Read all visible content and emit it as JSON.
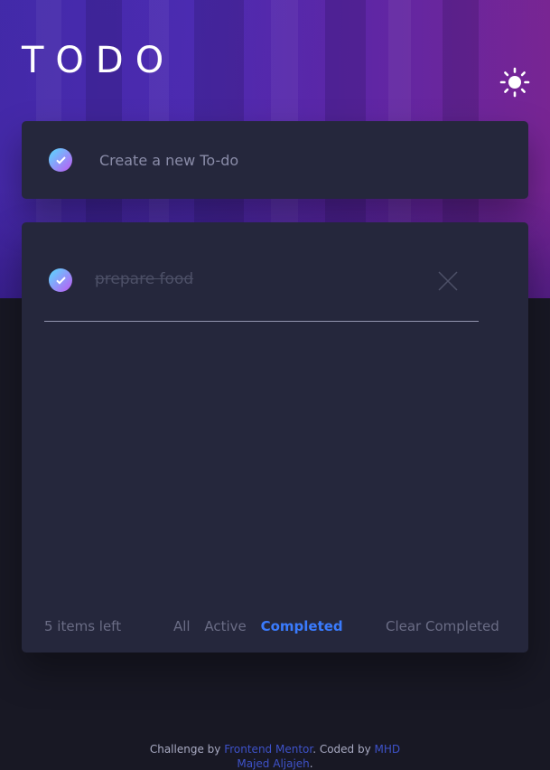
{
  "app": {
    "title": "TODO"
  },
  "theme_toggle": {
    "icon": "sun-icon"
  },
  "create": {
    "placeholder": "Create a new To-do",
    "value": ""
  },
  "todos": [
    {
      "text": "prepare food",
      "completed": true
    }
  ],
  "footer": {
    "items_left": "5 items left",
    "filters": [
      "All",
      "Active",
      "Completed"
    ],
    "active_filter": "Completed",
    "clear_label": "Clear Completed"
  },
  "attribution": {
    "prefix": "Challenge by",
    "link1": "Frontend Mentor",
    "middle": ". Coded by",
    "link2a": "MHD",
    "link2b": "Majed Aljajeh",
    "suffix": "."
  },
  "colors": {
    "accent": "#3a7bfd",
    "card_bg": "#25273c",
    "page_bg": "#181824",
    "check_gradient_start": "#57ddff",
    "check_gradient_end": "#c058f3"
  }
}
